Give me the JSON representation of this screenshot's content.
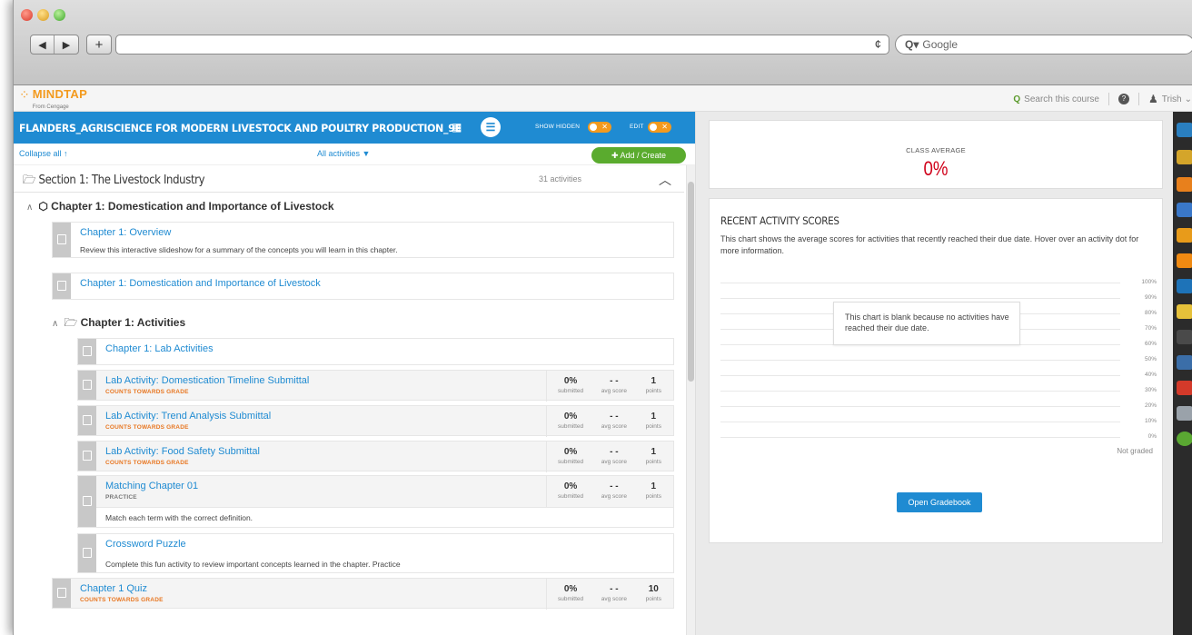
{
  "browser": {
    "search_placeholder": "Google",
    "nav_back": "◀",
    "nav_forward": "▶",
    "new_tab": "+",
    "reload": "¢"
  },
  "app": {
    "logo": "MINDTAP",
    "logo_sub": "From Cengage",
    "search_course": "Search this course",
    "user": "Trish"
  },
  "course": {
    "title": "FLANDERS_AGRISCIENCE FOR MODERN LIVESTOCK AND POULTRY PRODUCTION_9E",
    "show_hidden": "SHOW HIDDEN",
    "edit": "EDIT"
  },
  "toolbar": {
    "collapse_all": "Collapse all",
    "all_activities": "All activities",
    "add_create": "Add / Create"
  },
  "section": {
    "title": "Section 1: The Livestock Industry",
    "count": "31 activities"
  },
  "chapter": {
    "title": "Chapter 1: Domestication and Importance of Livestock"
  },
  "items": [
    {
      "title": "Chapter 1: Overview",
      "desc": "Review this interactive slideshow for a summary of the concepts you will learn in this chapter."
    },
    {
      "title": "Chapter 1: Domestication and Importance of Livestock"
    }
  ],
  "activities_folder": {
    "title": "Chapter 1: Activities"
  },
  "activities": [
    {
      "title": "Chapter 1: Lab Activities"
    },
    {
      "title": "Lab Activity: Domestication Timeline Submittal",
      "tag": "COUNTS TOWARDS GRADE",
      "submitted": "0%",
      "avg": "- -",
      "points": "1"
    },
    {
      "title": "Lab Activity: Trend Analysis Submittal",
      "tag": "COUNTS TOWARDS GRADE",
      "submitted": "0%",
      "avg": "- -",
      "points": "1"
    },
    {
      "title": "Lab Activity: Food Safety Submittal",
      "tag": "COUNTS TOWARDS GRADE",
      "submitted": "0%",
      "avg": "- -",
      "points": "1"
    },
    {
      "title": "Matching Chapter 01",
      "tag": "PRACTICE",
      "submitted": "0%",
      "avg": "- -",
      "points": "1",
      "desc": "Match each term with the correct definition."
    },
    {
      "title": "Crossword Puzzle",
      "desc": "Complete this fun activity to review important concepts learned in the chapter. Practice"
    }
  ],
  "quiz": {
    "title": "Chapter 1 Quiz",
    "tag": "COUNTS TOWARDS GRADE",
    "submitted": "0%",
    "avg": "- -",
    "points": "10"
  },
  "stat_labels": {
    "submitted": "submitted",
    "avg": "avg score",
    "points": "points"
  },
  "class_average": {
    "label": "CLASS AVERAGE",
    "value": "0%"
  },
  "recent": {
    "title": "RECENT ACTIVITY SCORES",
    "desc": "This chart shows the average scores for activities that recently reached their due date. Hover over an activity dot for more information.",
    "y_ticks": [
      "100%",
      "90%",
      "80%",
      "70%",
      "60%",
      "50%",
      "40%",
      "30%",
      "20%",
      "10%",
      "0%"
    ],
    "blank_msg": "This chart is blank because no activities have reached their due date.",
    "not_graded": "Not graded",
    "open_gradebook": "Open Gradebook"
  },
  "colors": {
    "accent": "#1f8bd2",
    "orange": "#f39a1e",
    "green": "#5aab2e",
    "red": "#d0021b"
  }
}
